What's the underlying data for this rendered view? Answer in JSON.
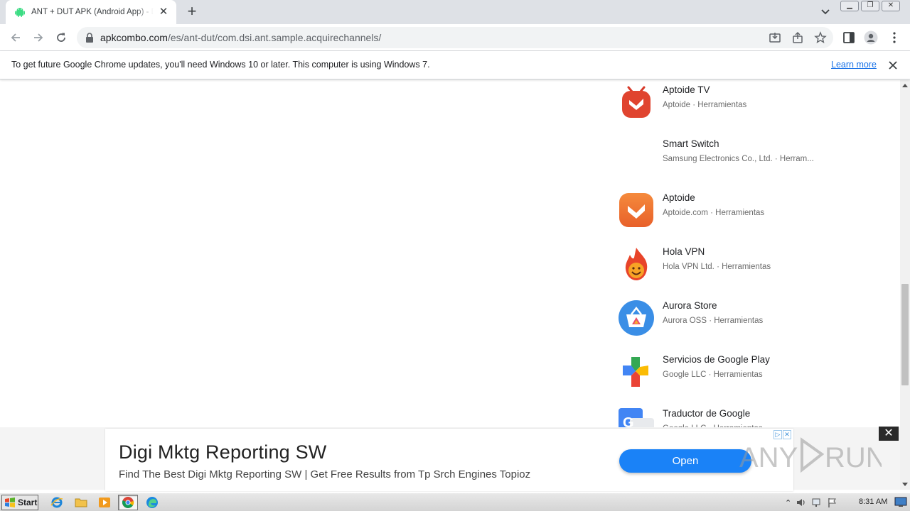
{
  "browser": {
    "tab_title": "ANT + DUT APK (Android App) - Descargar Gratis",
    "url_host": "apkcombo.com",
    "url_path": "/es/ant-dut/com.dsi.ant.sample.acquirechannels/"
  },
  "infobar": {
    "message": "To get future Google Chrome updates, you'll need Windows 10 or later. This computer is using Windows 7.",
    "link": "Learn more"
  },
  "apps": [
    {
      "name": "Aptoide TV",
      "meta": "Aptoide · Herramientas",
      "icon": "aptoide-tv-icon"
    },
    {
      "name": "Smart Switch",
      "meta": "Samsung Electronics Co., Ltd. · Herram...",
      "icon": "smart-switch-icon"
    },
    {
      "name": "Aptoide",
      "meta": "Aptoide.com · Herramientas",
      "icon": "aptoide-icon"
    },
    {
      "name": "Hola VPN",
      "meta": "Hola VPN Ltd. · Herramientas",
      "icon": "hola-vpn-icon"
    },
    {
      "name": "Aurora Store",
      "meta": "Aurora OSS · Herramientas",
      "icon": "aurora-store-icon"
    },
    {
      "name": "Servicios de Google Play",
      "meta": "Google LLC · Herramientas",
      "icon": "google-play-services-icon"
    },
    {
      "name": "Traductor de Google",
      "meta": "Google LLC · Herramientas",
      "icon": "google-translate-icon"
    }
  ],
  "ad": {
    "title": "Digi Mktg Reporting SW",
    "description": "Find The Best Digi Mktg Reporting SW | Get Free Results from Tp Srch Engines Topioz",
    "button": "Open"
  },
  "watermark": "ANY RUN",
  "taskbar": {
    "start": "Start",
    "clock": "8:31 AM"
  },
  "colors": {
    "chrome_tabstrip": "#dee1e6",
    "ad_button": "#1a82f7",
    "link": "#1a73e8"
  }
}
